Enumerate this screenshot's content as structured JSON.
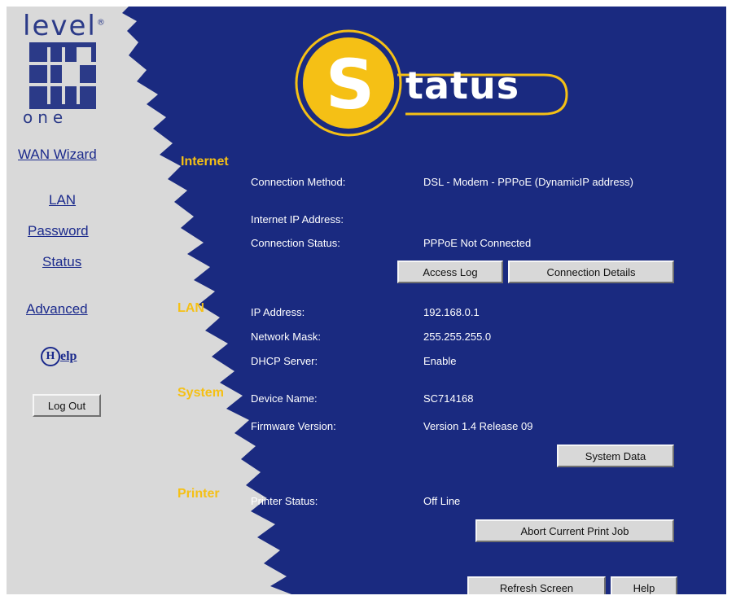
{
  "logo": {
    "top_text": "level",
    "tm": "®",
    "bottom_text": "one"
  },
  "nav": {
    "wan_wizard": "WAN Wizard",
    "lan": "LAN",
    "password": "Password",
    "status": "Status",
    "advanced": "Advanced",
    "help": "elp",
    "help_h": "H",
    "logout": "Log Out"
  },
  "banner": {
    "letter": "S",
    "word": "tatus"
  },
  "sections": {
    "internet": {
      "heading": "Internet",
      "connection_method_label": "Connection Method:",
      "connection_method_value": "DSL - Modem - PPPoE (DynamicIP address)",
      "ip_label": "Internet IP Address:",
      "ip_value": "",
      "status_label": "Connection Status:",
      "status_value": "PPPoE Not Connected",
      "access_log_button": "Access Log",
      "connection_details_button": "Connection Details"
    },
    "lan": {
      "heading": "LAN",
      "ip_label": "IP Address:",
      "ip_value": "192.168.0.1",
      "mask_label": "Network Mask:",
      "mask_value": "255.255.255.0",
      "dhcp_label": "DHCP Server:",
      "dhcp_value": "Enable"
    },
    "system": {
      "heading": "System",
      "device_label": "Device Name:",
      "device_value": "SC714168",
      "firmware_label": "Firmware Version:",
      "firmware_value": "Version 1.4 Release 09",
      "system_data_button": "System Data"
    },
    "printer": {
      "heading": "Printer",
      "status_label": "Printer Status:",
      "status_value": "Off Line",
      "abort_button": "Abort Current Print Job"
    }
  },
  "footer": {
    "refresh_button": "Refresh Screen",
    "help_button": "Help"
  },
  "colors": {
    "background": "#1a2a80",
    "sidebar": "#d9d9d9",
    "accent": "#f5c015",
    "link": "#1b2a8c"
  }
}
